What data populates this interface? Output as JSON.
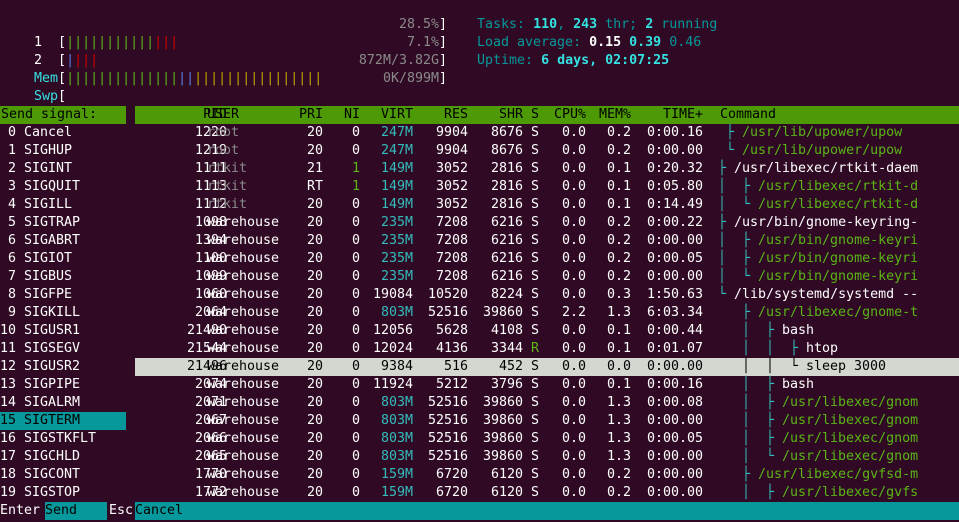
{
  "meters": {
    "cpu1": {
      "label": "1",
      "bar_green": "|||||||||||",
      "bar_red": "|||",
      "percent": "28.5%"
    },
    "cpu2": {
      "label": "2",
      "bar_blue": "|",
      "bar_red": "|||",
      "percent": "7.1%"
    },
    "mem": {
      "label": "Mem",
      "bar_green": "||||||||||||||",
      "bar_blue": "||",
      "bar_yellow": "||||||||||||||||",
      "value": "872M/3.82G"
    },
    "swp": {
      "label": "Swp",
      "value": "0K/899M"
    }
  },
  "stats": {
    "tasks_label": "Tasks:",
    "tasks": "110",
    "thr": "243",
    "thr_label": "thr;",
    "running": "2",
    "running_label": "running",
    "load_label": "Load average:",
    "load1": "0.15",
    "load5": "0.39",
    "load15": "0.46",
    "uptime_label": "Uptime:",
    "uptime": "6 days, 02:07:25"
  },
  "signal_panel": {
    "title": "Send signal:",
    "signals": [
      "0 Cancel",
      "1 SIGHUP",
      "2 SIGINT",
      "3 SIGQUIT",
      "4 SIGILL",
      "5 SIGTRAP",
      "6 SIGABRT",
      "6 SIGIOT",
      "7 SIGBUS",
      "8 SIGFPE",
      "9 SIGKILL",
      "10 SIGUSR1",
      "11 SIGSEGV",
      "12 SIGUSR2",
      "13 SIGPIPE",
      "14 SIGALRM",
      "15 SIGTERM",
      "16 SIGSTKFLT",
      "17 SIGCHLD",
      "18 SIGCONT",
      "19 SIGSTOP"
    ]
  },
  "columns": {
    "pid": "PID",
    "user": "USER",
    "pri": "PRI",
    "ni": "NI",
    "virt": "VIRT",
    "res": "RES",
    "shr": "SHR",
    "s": "S",
    "cpu": "CPU%",
    "mem": "MEM%",
    "time": "TIME+",
    "command": "Command"
  },
  "processes": [
    {
      "pid": "1220",
      "user": "root",
      "pri": "20",
      "ni": "0",
      "virt": "247M",
      "res": "9904",
      "shr": "8676",
      "s": "S",
      "cpu": "0.0",
      "mem": "0.2",
      "time": "0:00.16",
      "tree": " ├ ",
      "cmd": "/usr/lib/upower/upow"
    },
    {
      "pid": "1219",
      "user": "root",
      "pri": "20",
      "ni": "0",
      "virt": "247M",
      "res": "9904",
      "shr": "8676",
      "s": "S",
      "cpu": "0.0",
      "mem": "0.2",
      "time": "0:00.00",
      "tree": " └ ",
      "cmd": "/usr/lib/upower/upow"
    },
    {
      "pid": "1111",
      "user": "rtkit",
      "pri": "21",
      "ni": "1",
      "virt": "149M",
      "res": "3052",
      "shr": "2816",
      "s": "S",
      "cpu": "0.0",
      "mem": "0.1",
      "time": "0:20.32",
      "tree": "├ ",
      "cmd": "/usr/libexec/rtkit-daem"
    },
    {
      "pid": "1113",
      "user": "rtkit",
      "pri": "RT",
      "ni": "1",
      "virt": "149M",
      "res": "3052",
      "shr": "2816",
      "s": "S",
      "cpu": "0.0",
      "mem": "0.1",
      "time": "0:05.80",
      "tree": "│  ├ ",
      "cmd": "/usr/libexec/rtkit-d"
    },
    {
      "pid": "1112",
      "user": "rtkit",
      "pri": "20",
      "ni": "0",
      "virt": "149M",
      "res": "3052",
      "shr": "2816",
      "s": "S",
      "cpu": "0.0",
      "mem": "0.1",
      "time": "0:14.49",
      "tree": "│  └ ",
      "cmd": "/usr/libexec/rtkit-d"
    },
    {
      "pid": "1098",
      "user": "warehouse",
      "pri": "20",
      "ni": "0",
      "virt": "235M",
      "res": "7208",
      "shr": "6216",
      "s": "S",
      "cpu": "0.0",
      "mem": "0.2",
      "time": "0:00.22",
      "tree": "├ ",
      "cmd": "/usr/bin/gnome-keyring-"
    },
    {
      "pid": "1394",
      "user": "warehouse",
      "pri": "20",
      "ni": "0",
      "virt": "235M",
      "res": "7208",
      "shr": "6216",
      "s": "S",
      "cpu": "0.0",
      "mem": "0.2",
      "time": "0:00.00",
      "tree": "│  ├ ",
      "cmd": "/usr/bin/gnome-keyri"
    },
    {
      "pid": "1100",
      "user": "warehouse",
      "pri": "20",
      "ni": "0",
      "virt": "235M",
      "res": "7208",
      "shr": "6216",
      "s": "S",
      "cpu": "0.0",
      "mem": "0.2",
      "time": "0:00.05",
      "tree": "│  ├ ",
      "cmd": "/usr/bin/gnome-keyri"
    },
    {
      "pid": "1099",
      "user": "warehouse",
      "pri": "20",
      "ni": "0",
      "virt": "235M",
      "res": "7208",
      "shr": "6216",
      "s": "S",
      "cpu": "0.0",
      "mem": "0.2",
      "time": "0:00.00",
      "tree": "│  └ ",
      "cmd": "/usr/bin/gnome-keyri"
    },
    {
      "pid": "1060",
      "user": "warehouse",
      "pri": "20",
      "ni": "0",
      "virt": "19084",
      "res": "10520",
      "shr": "8224",
      "s": "S",
      "cpu": "0.0",
      "mem": "0.3",
      "time": "1:50.63",
      "tree": "└ ",
      "cmd": "/lib/systemd/systemd --"
    },
    {
      "pid": "2064",
      "user": "warehouse",
      "pri": "20",
      "ni": "0",
      "virt": "803M",
      "res": "52516",
      "shr": "39860",
      "s": "S",
      "cpu": "2.2",
      "mem": "1.3",
      "time": "6:03.34",
      "tree": "   ├ ",
      "cmd": "/usr/libexec/gnome-t"
    },
    {
      "pid": "21490",
      "user": "warehouse",
      "pri": "20",
      "ni": "0",
      "virt": "12056",
      "res": "5628",
      "shr": "4108",
      "s": "S",
      "cpu": "0.0",
      "mem": "0.1",
      "time": "0:00.44",
      "tree": "   │  ├ ",
      "cmd": "bash"
    },
    {
      "pid": "21544",
      "user": "warehouse",
      "pri": "20",
      "ni": "0",
      "virt": "12024",
      "res": "4136",
      "shr": "3344",
      "s": "R",
      "cpu": "0.0",
      "mem": "0.1",
      "time": "0:01.07",
      "tree": "   │  │  ├ ",
      "cmd": "htop"
    },
    {
      "pid": "21496",
      "user": "warehouse",
      "pri": "20",
      "ni": "0",
      "virt": "9384",
      "res": "516",
      "shr": "452",
      "s": "S",
      "cpu": "0.0",
      "mem": "0.0",
      "time": "0:00.00",
      "tree": "   │  │  └ ",
      "cmd": "sleep 3000"
    },
    {
      "pid": "2074",
      "user": "warehouse",
      "pri": "20",
      "ni": "0",
      "virt": "11924",
      "res": "5212",
      "shr": "3796",
      "s": "S",
      "cpu": "0.0",
      "mem": "0.1",
      "time": "0:00.16",
      "tree": "   │  ├ ",
      "cmd": "bash"
    },
    {
      "pid": "2071",
      "user": "warehouse",
      "pri": "20",
      "ni": "0",
      "virt": "803M",
      "res": "52516",
      "shr": "39860",
      "s": "S",
      "cpu": "0.0",
      "mem": "1.3",
      "time": "0:00.08",
      "tree": "   │  ├ ",
      "cmd": "/usr/libexec/gnom"
    },
    {
      "pid": "2067",
      "user": "warehouse",
      "pri": "20",
      "ni": "0",
      "virt": "803M",
      "res": "52516",
      "shr": "39860",
      "s": "S",
      "cpu": "0.0",
      "mem": "1.3",
      "time": "0:00.00",
      "tree": "   │  ├ ",
      "cmd": "/usr/libexec/gnom"
    },
    {
      "pid": "2066",
      "user": "warehouse",
      "pri": "20",
      "ni": "0",
      "virt": "803M",
      "res": "52516",
      "shr": "39860",
      "s": "S",
      "cpu": "0.0",
      "mem": "1.3",
      "time": "0:00.05",
      "tree": "   │  ├ ",
      "cmd": "/usr/libexec/gnom"
    },
    {
      "pid": "2065",
      "user": "warehouse",
      "pri": "20",
      "ni": "0",
      "virt": "803M",
      "res": "52516",
      "shr": "39860",
      "s": "S",
      "cpu": "0.0",
      "mem": "1.3",
      "time": "0:00.00",
      "tree": "   │  └ ",
      "cmd": "/usr/libexec/gnom"
    },
    {
      "pid": "1770",
      "user": "warehouse",
      "pri": "20",
      "ni": "0",
      "virt": "159M",
      "res": "6720",
      "shr": "6120",
      "s": "S",
      "cpu": "0.0",
      "mem": "0.2",
      "time": "0:00.00",
      "tree": "   ├ ",
      "cmd": "/usr/libexec/gvfsd-m"
    },
    {
      "pid": "1772",
      "user": "warehouse",
      "pri": "20",
      "ni": "0",
      "virt": "159M",
      "res": "6720",
      "shr": "6120",
      "s": "S",
      "cpu": "0.0",
      "mem": "0.2",
      "time": "0:00.00",
      "tree": "   │  ├ ",
      "cmd": "/usr/libexec/gvfs"
    }
  ],
  "footer": {
    "enter_key": "Enter",
    "enter_label": "Send",
    "esc_key": "Esc",
    "esc_label": "Cancel"
  },
  "colors": {
    "background": "#300a24",
    "header_green": "#4e9a06",
    "selection_teal": "#06989a",
    "selected_row": "#d3d7cf"
  }
}
